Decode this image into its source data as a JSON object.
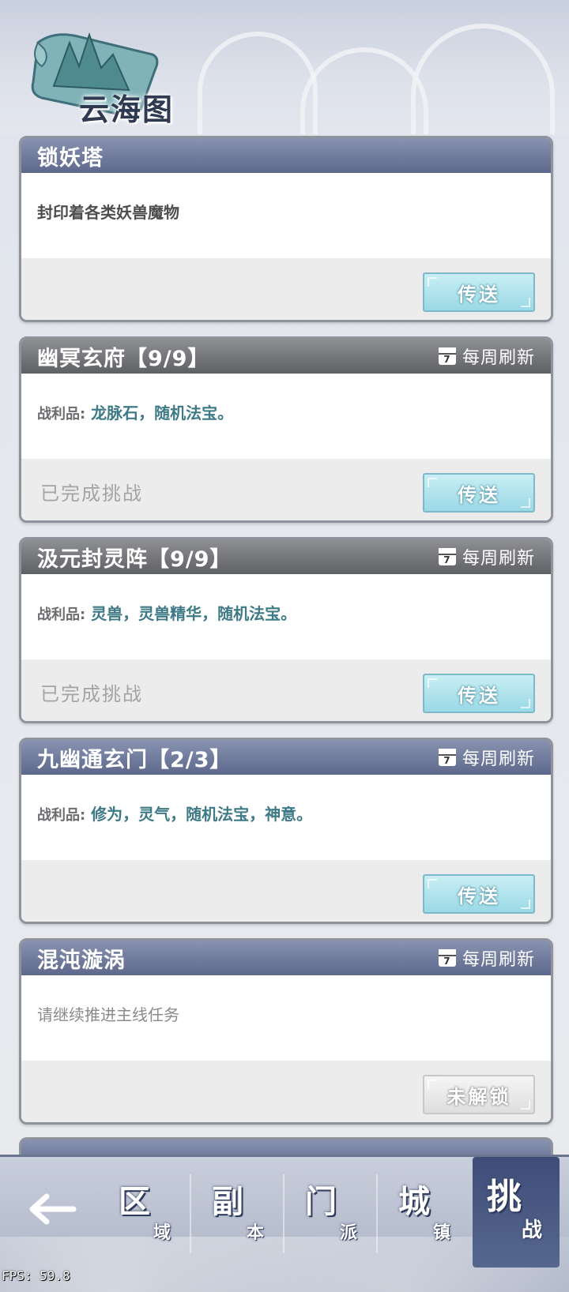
{
  "header": {
    "title": "云海图"
  },
  "cards": [
    {
      "title": "锁妖塔",
      "refresh_label": "",
      "desc": "封印着各类妖兽魔物",
      "loot_label": "",
      "loot_items": "",
      "status": "",
      "button": "传送"
    },
    {
      "title": "幽冥玄府【9/9】",
      "refresh_label": "每周刷新",
      "desc": "",
      "loot_label": "战利品:",
      "loot_items": "龙脉石，随机法宝。",
      "status": "已完成挑战",
      "button": "传送"
    },
    {
      "title": "汲元封灵阵【9/9】",
      "refresh_label": "每周刷新",
      "desc": "",
      "loot_label": "战利品:",
      "loot_items": "灵兽，灵兽精华，随机法宝。",
      "status": "已完成挑战",
      "button": "传送"
    },
    {
      "title": "九幽通玄门【2/3】",
      "refresh_label": "每周刷新",
      "desc": "",
      "loot_label": "战利品:",
      "loot_items": "修为，灵气，随机法宝，神意。",
      "status": "",
      "button": "传送"
    },
    {
      "title": "混沌漩涡",
      "refresh_label": "每周刷新",
      "desc": "请继续推进主线任务",
      "loot_label": "",
      "loot_items": "",
      "status": "",
      "button": "未解锁"
    }
  ],
  "calendar_icon_day": "7",
  "nav": {
    "tabs": [
      {
        "big": "区",
        "small": "域"
      },
      {
        "big": "副",
        "small": "本"
      },
      {
        "big": "门",
        "small": "派"
      },
      {
        "big": "城",
        "small": "镇"
      },
      {
        "big": "挑",
        "small": "战"
      }
    ],
    "active_tab": 4
  },
  "fps": "FPS: 59.8",
  "colors": {
    "card_header_active": "#5d688c",
    "card_header_done": "#5f6064",
    "teleport_button": "#9ad9e6",
    "loot_text": "#3e7a86"
  }
}
